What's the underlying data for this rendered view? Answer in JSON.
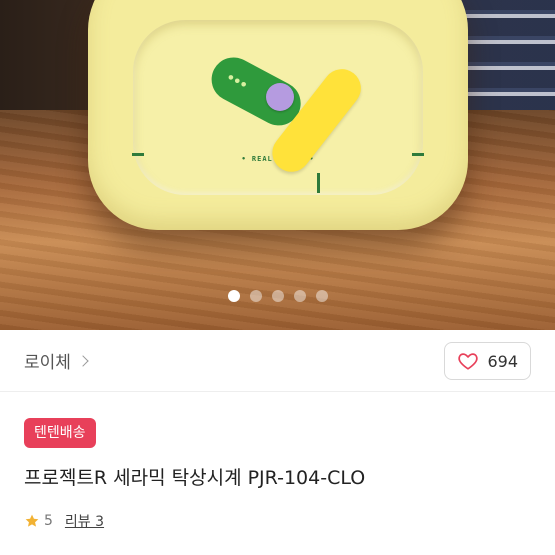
{
  "clock_brand_text": "• REAL CLOCK •",
  "carousel": {
    "count": 5,
    "active_index": 0
  },
  "brand": {
    "name": "로이체"
  },
  "like": {
    "count": "694"
  },
  "badge": {
    "label": "텐텐배송"
  },
  "product": {
    "title": "프로젝트R 세라믹 탁상시계 PJR-104-CLO"
  },
  "rating": {
    "value": "5",
    "review_label": "리뷰 3"
  },
  "colors": {
    "badge": "#e8405a",
    "heart": "#e8405a",
    "star": "#f2b233"
  }
}
